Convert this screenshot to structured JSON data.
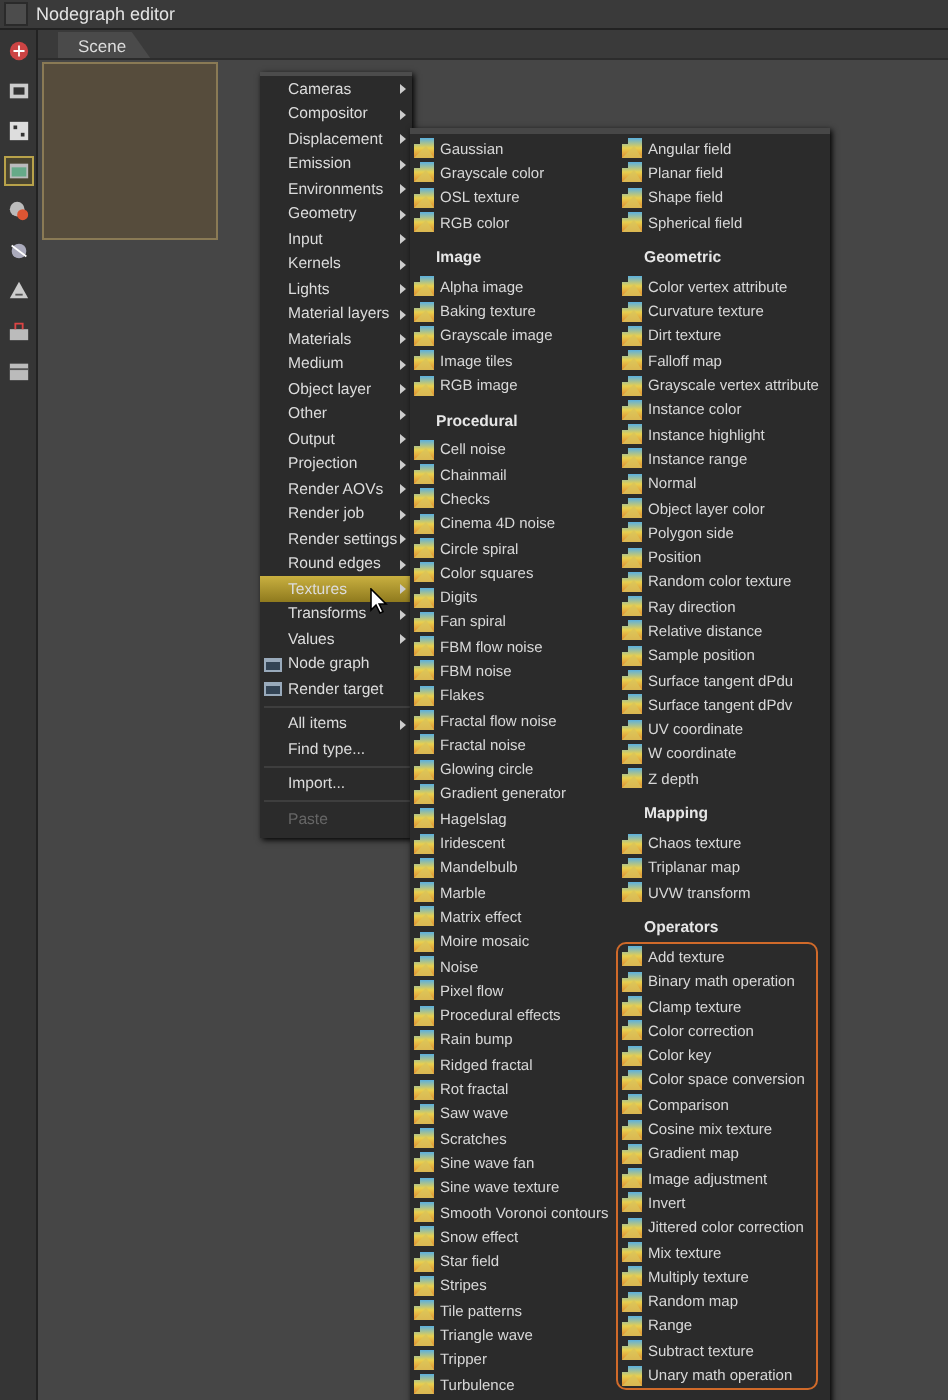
{
  "window": {
    "title": "Nodegraph editor"
  },
  "toolbar": [
    {
      "selected": false
    },
    {
      "selected": false
    },
    {
      "selected": false
    },
    {
      "selected": true
    },
    {
      "selected": false
    },
    {
      "selected": false
    },
    {
      "selected": false
    },
    {
      "selected": false
    },
    {
      "selected": false
    }
  ],
  "tabs": [
    {
      "label": "Scene",
      "selected": true
    }
  ],
  "menu": {
    "items": [
      {
        "kind": "submenu",
        "label": "Cameras",
        "selected": false,
        "disabled": false
      },
      {
        "kind": "submenu",
        "label": "Compositor",
        "selected": false,
        "disabled": false
      },
      {
        "kind": "submenu",
        "label": "Displacement",
        "selected": false,
        "disabled": false
      },
      {
        "kind": "submenu",
        "label": "Emission",
        "selected": false,
        "disabled": false
      },
      {
        "kind": "submenu",
        "label": "Environments",
        "selected": false,
        "disabled": false
      },
      {
        "kind": "submenu",
        "label": "Geometry",
        "selected": false,
        "disabled": false
      },
      {
        "kind": "submenu",
        "label": "Input",
        "selected": false,
        "disabled": false
      },
      {
        "kind": "submenu",
        "label": "Kernels",
        "selected": false,
        "disabled": false
      },
      {
        "kind": "submenu",
        "label": "Lights",
        "selected": false,
        "disabled": false
      },
      {
        "kind": "submenu",
        "label": "Material layers",
        "selected": false,
        "disabled": false
      },
      {
        "kind": "submenu",
        "label": "Materials",
        "selected": false,
        "disabled": false
      },
      {
        "kind": "submenu",
        "label": "Medium",
        "selected": false,
        "disabled": false
      },
      {
        "kind": "submenu",
        "label": "Object layer",
        "selected": false,
        "disabled": false
      },
      {
        "kind": "submenu",
        "label": "Other",
        "selected": false,
        "disabled": false
      },
      {
        "kind": "submenu",
        "label": "Output",
        "selected": false,
        "disabled": false
      },
      {
        "kind": "submenu",
        "label": "Projection",
        "selected": false,
        "disabled": false
      },
      {
        "kind": "submenu",
        "label": "Render AOVs",
        "selected": false,
        "disabled": false
      },
      {
        "kind": "submenu",
        "label": "Render job",
        "selected": false,
        "disabled": false
      },
      {
        "kind": "submenu",
        "label": "Render settings",
        "selected": false,
        "disabled": false
      },
      {
        "kind": "submenu",
        "label": "Round edges",
        "selected": false,
        "disabled": false
      },
      {
        "kind": "submenu",
        "label": "Textures",
        "selected": true,
        "disabled": false
      },
      {
        "kind": "submenu",
        "label": "Transforms",
        "selected": false,
        "disabled": false
      },
      {
        "kind": "submenu",
        "label": "Values",
        "selected": false,
        "disabled": false
      },
      {
        "kind": "node",
        "label": "Node graph",
        "selected": false,
        "disabled": false
      },
      {
        "kind": "node",
        "label": "Render target",
        "selected": false,
        "disabled": false
      },
      {
        "kind": "separator"
      },
      {
        "kind": "submenu",
        "label": "All items",
        "selected": false,
        "disabled": false
      },
      {
        "kind": "command",
        "label": "Find type...",
        "selected": false,
        "disabled": false
      },
      {
        "kind": "separator"
      },
      {
        "kind": "command",
        "label": "Import...",
        "selected": false,
        "disabled": false
      },
      {
        "kind": "separator"
      },
      {
        "kind": "command",
        "label": "Paste",
        "selected": false,
        "disabled": true
      }
    ]
  },
  "submenu": {
    "columns": [
      {
        "sections": [
          {
            "items": [
              "Gaussian",
              "Grayscale color",
              "OSL texture",
              "RGB color"
            ]
          },
          {
            "heading": "Image",
            "items": [
              "Alpha image",
              "Baking texture",
              "Grayscale image",
              "Image tiles",
              "RGB image"
            ]
          },
          {
            "heading": "Procedural",
            "items": [
              "Cell noise",
              "Chainmail",
              "Checks",
              "Cinema 4D noise",
              "Circle spiral",
              "Color squares",
              "Digits",
              "Fan spiral",
              "FBM flow noise",
              "FBM noise",
              "Flakes",
              "Fractal flow noise",
              "Fractal noise",
              "Glowing circle",
              "Gradient generator",
              "Hagelslag",
              "Iridescent",
              "Mandelbulb",
              "Marble",
              "Matrix effect",
              "Moire mosaic",
              "Noise",
              "Pixel flow",
              "Procedural effects",
              "Rain bump",
              "Ridged fractal",
              "Rot fractal",
              "Saw wave",
              "Scratches",
              "Sine wave fan",
              "Sine wave texture",
              "Smooth Voronoi contours",
              "Snow effect",
              "Star field",
              "Stripes",
              "Tile patterns",
              "Triangle wave",
              "Tripper",
              "Turbulence"
            ]
          }
        ]
      },
      {
        "sections": [
          {
            "items": [
              "Angular field",
              "Planar field",
              "Shape field",
              "Spherical field"
            ]
          },
          {
            "heading": "Geometric",
            "items": [
              "Color vertex attribute",
              "Curvature texture",
              "Dirt texture",
              "Falloff map",
              "Grayscale vertex attribute",
              "Instance color",
              "Instance highlight",
              "Instance range",
              "Normal",
              "Object layer color",
              "Polygon side",
              "Position",
              "Random color texture",
              "Ray direction",
              "Relative distance",
              "Sample position",
              "Surface tangent dPdu",
              "Surface tangent dPdv",
              "UV coordinate",
              "W coordinate",
              "Z depth"
            ]
          },
          {
            "heading": "Mapping",
            "items": [
              "Chaos texture",
              "Triplanar map",
              "UVW transform"
            ]
          },
          {
            "heading": "Operators",
            "framed": true,
            "items": [
              "Add texture",
              "Binary math operation",
              "Clamp texture",
              "Color correction",
              "Color key",
              "Color space conversion",
              "Comparison",
              "Cosine mix texture",
              "Gradient map",
              "Image adjustment",
              "Invert",
              "Jittered color correction",
              "Mix texture",
              "Multiply texture",
              "Random map",
              "Range",
              "Subtract texture",
              "Unary math operation"
            ]
          }
        ]
      }
    ]
  }
}
